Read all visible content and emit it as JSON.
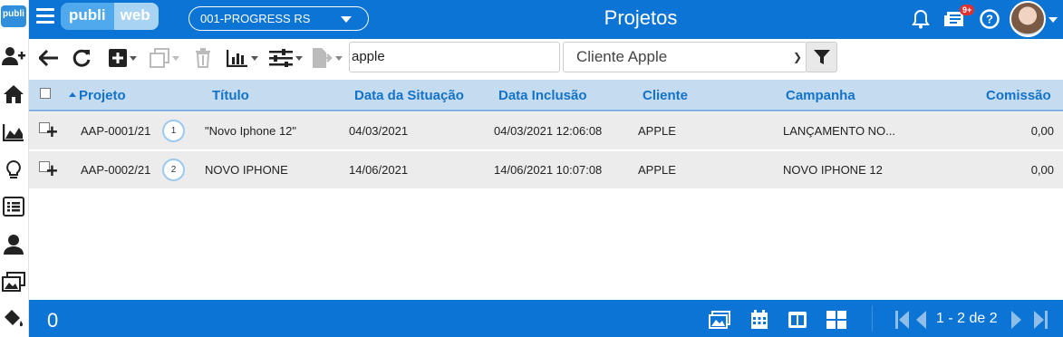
{
  "app": {
    "brand_primary": "publi",
    "brand_secondary": "web",
    "sidebar_logo": "publi",
    "company": "001-PROGRESS RS",
    "title": "Projetos",
    "notification_badge": "9+",
    "colors": {
      "header": "#0b74d4",
      "table_header": "#c4dbf0",
      "row": "#ececec",
      "link": "#1273c9"
    }
  },
  "sidebar": {
    "icons": [
      "publiweb-logo",
      "add-user-icon",
      "home-icon",
      "chart-icon",
      "lightbulb-icon",
      "list-icon",
      "contacts-icon",
      "images-icon",
      "paint-bucket-icon"
    ]
  },
  "toolbar": {
    "search_value": "apple",
    "client_filter": "Cliente Apple",
    "icons": [
      "back-arrow-icon",
      "refresh-icon",
      "add-icon",
      "copy-icon",
      "trash-icon",
      "report-chart-icon",
      "sliders-icon",
      "export-icon",
      "filter-icon"
    ]
  },
  "table": {
    "headers": {
      "projeto": "Projeto",
      "titulo": "Título",
      "data_situacao": "Data da Situação",
      "data_inclusao": "Data Inclusão",
      "cliente": "Cliente",
      "campanha": "Campanha",
      "comissao": "Comissão"
    },
    "rows": [
      {
        "projeto": "AAP-0001/21",
        "num": "1",
        "titulo": "\"Novo Iphone 12\"",
        "data_situacao": "04/03/2021",
        "data_inclusao": "04/03/2021 12:06:08",
        "cliente": "APPLE",
        "campanha": "LANÇAMENTO NO...",
        "comissao": "0,00"
      },
      {
        "projeto": "AAP-0002/21",
        "num": "2",
        "titulo": "NOVO IPHONE",
        "data_situacao": "14/06/2021",
        "data_inclusao": "14/06/2021 10:07:08",
        "cliente": "APPLE",
        "campanha": "NOVO IPHONE 12",
        "comissao": "0,00"
      }
    ]
  },
  "footer": {
    "selected_count": "0",
    "pagination": "1 - 2 de 2",
    "icons": [
      "gallery-icon",
      "calendar-icon",
      "columns-icon",
      "grid-icon",
      "first-page-icon",
      "prev-page-icon",
      "next-page-icon",
      "last-page-icon"
    ]
  }
}
